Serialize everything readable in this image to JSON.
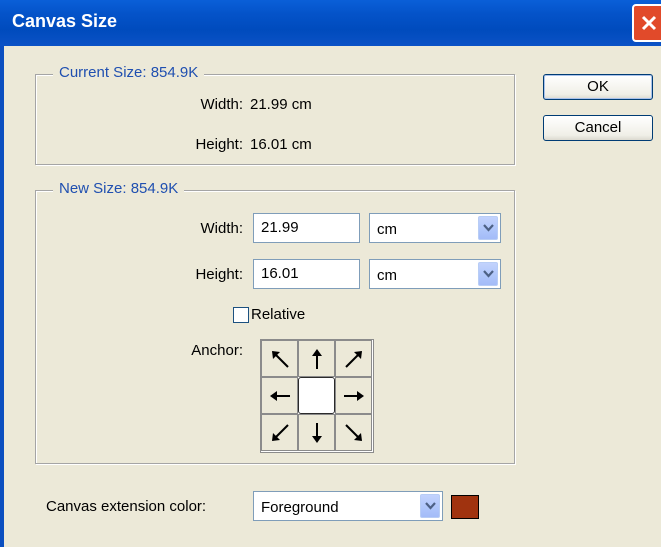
{
  "window": {
    "title": "Canvas Size"
  },
  "current_size": {
    "legend": "Current Size: 854.9K",
    "width_label": "Width:",
    "width_value": "21.99 cm",
    "height_label": "Height:",
    "height_value": "16.01 cm"
  },
  "new_size": {
    "legend": "New Size: 854.9K",
    "width_label": "Width:",
    "width_value": "21.99",
    "width_unit": "cm",
    "height_label": "Height:",
    "height_value": "16.01",
    "height_unit": "cm",
    "relative_label": "Relative",
    "relative_checked": false,
    "anchor_label": "Anchor:"
  },
  "buttons": {
    "ok": "OK",
    "cancel": "Cancel"
  },
  "extension": {
    "label": "Canvas extension color:",
    "value": "Foreground",
    "swatch_color": "#a0330f"
  },
  "colors": {
    "accent": "#1f4fb0",
    "title_bar": "#0453c9"
  }
}
